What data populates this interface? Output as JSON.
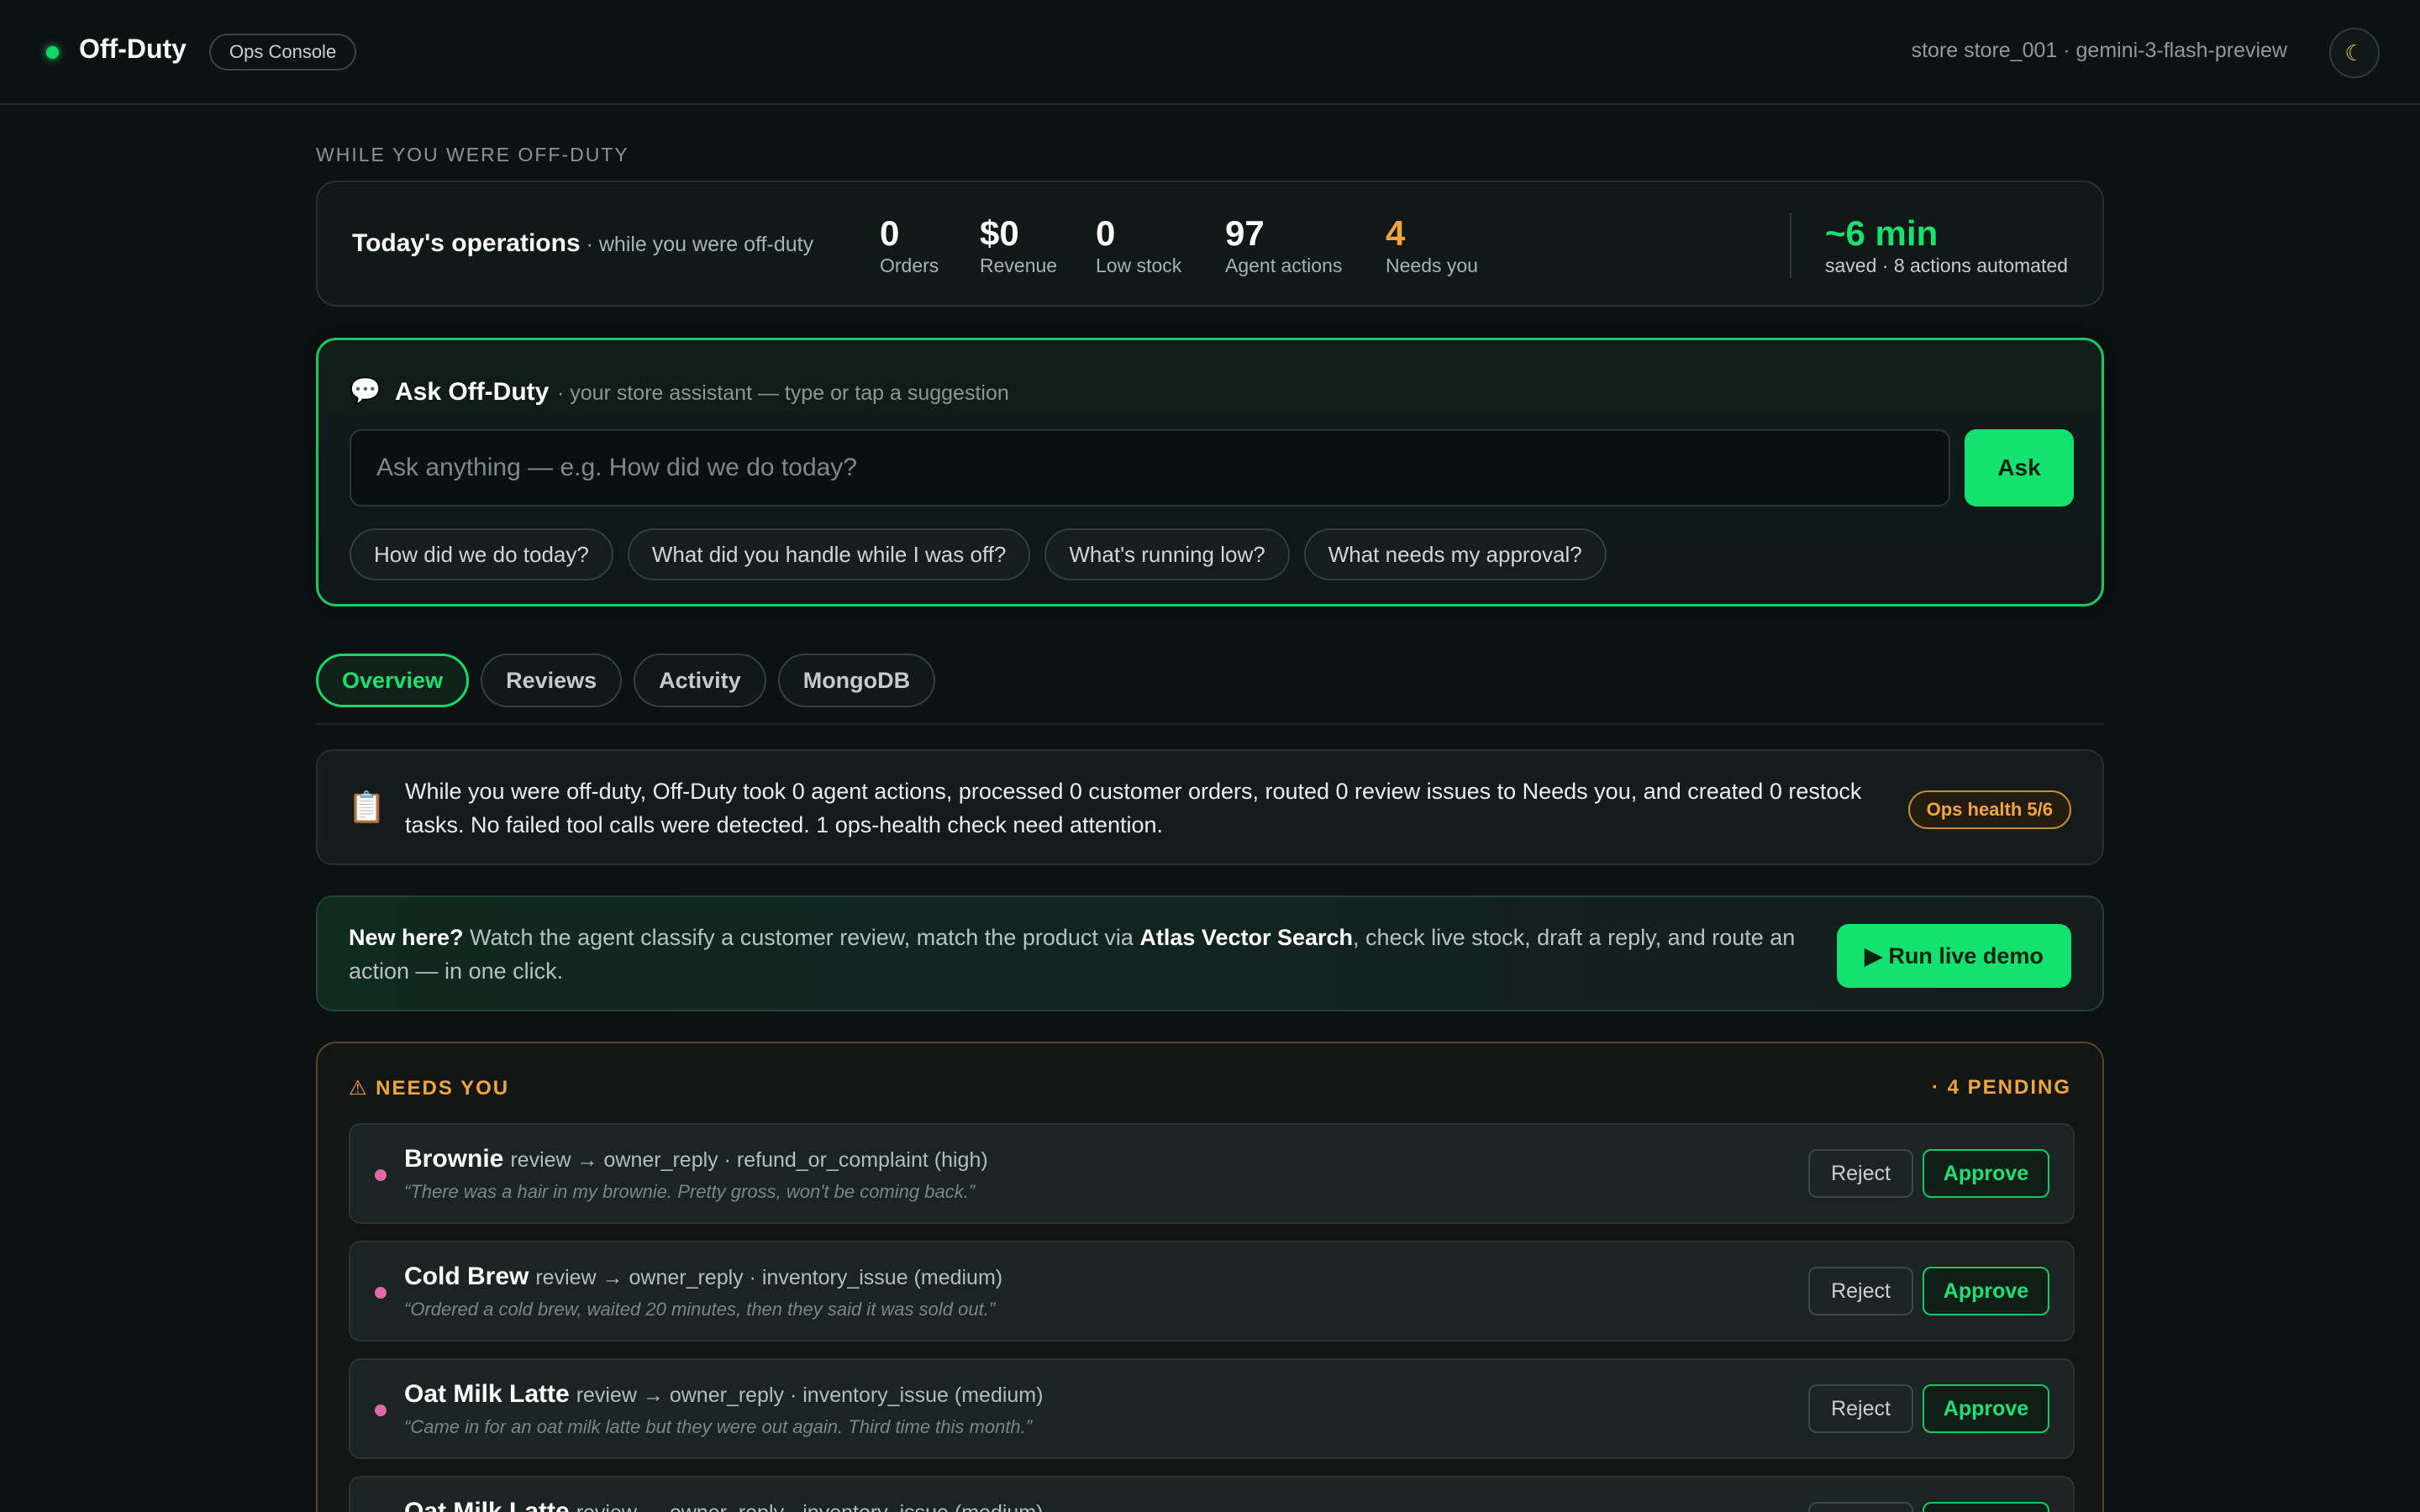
{
  "header": {
    "brand": "Off-Duty",
    "badge": "Ops Console",
    "store_meta": "store store_001 · gemini-3-flash-preview",
    "theme_icon": "☾"
  },
  "section_label": "WHILE YOU WERE OFF-DUTY",
  "ops": {
    "title": "Today's operations",
    "subtitle": " · while you were off-duty",
    "stats": [
      {
        "value": "0",
        "label": "Orders"
      },
      {
        "value": "$0",
        "label": "Revenue"
      },
      {
        "value": "0",
        "label": "Low stock"
      },
      {
        "value": "97",
        "label": "Agent actions"
      },
      {
        "value": "4",
        "label": "Needs you"
      }
    ],
    "saved_value": "~6 min",
    "saved_label": "saved · 8 actions automated"
  },
  "ask": {
    "icon": "💬",
    "title": "Ask Off-Duty",
    "subtitle": "· your store assistant — type or tap a suggestion",
    "placeholder": "Ask anything — e.g. How did we do today?",
    "button": "Ask",
    "suggestions": [
      "How did we do today?",
      "What did you handle while I was off?",
      "What's running low?",
      "What needs my approval?"
    ]
  },
  "tabs": [
    "Overview",
    "Reviews",
    "Activity",
    "MongoDB"
  ],
  "active_tab": "Overview",
  "summary": {
    "icon": "📋",
    "text": "While you were off-duty, Off-Duty took 0 agent actions, processed 0 customer orders, routed 0 review issues to Needs you, and created 0 restock tasks. No failed tool calls were detected. 1 ops-health check need attention.",
    "health_badge": "Ops health 5/6"
  },
  "demo": {
    "lead": "New here?",
    "text_1": " Watch the agent classify a customer review, match the product via ",
    "highlight": "Atlas Vector Search",
    "text_2": ", check live stock, draft a reply, and route an action — in one click.",
    "button": "▶ Run live demo"
  },
  "needs_you": {
    "title": "⚠ NEEDS YOU",
    "count": "· 4 PENDING",
    "reject_label": "Reject",
    "approve_label": "Approve",
    "items": [
      {
        "item": "Brownie",
        "meta": "review → owner_reply · refund_or_complaint (high)",
        "quote": "“There was a hair in my brownie. Pretty gross, won't be coming back.”"
      },
      {
        "item": "Cold Brew",
        "meta": "review → owner_reply · inventory_issue (medium)",
        "quote": "“Ordered a cold brew, waited 20 minutes, then they said it was sold out.”"
      },
      {
        "item": "Oat Milk Latte",
        "meta": "review → owner_reply · inventory_issue (medium)",
        "quote": "“Came in for an oat milk latte but they were out again. Third time this month.”"
      },
      {
        "item": "Oat Milk Latte",
        "meta": "review → owner_reply · inventory_issue (medium)",
        "quote": ""
      }
    ]
  },
  "colors": {
    "accent": "#14e26f",
    "warning": "#f0a63c",
    "background": "#0c1111",
    "priority_dot": "#e06aa8"
  }
}
